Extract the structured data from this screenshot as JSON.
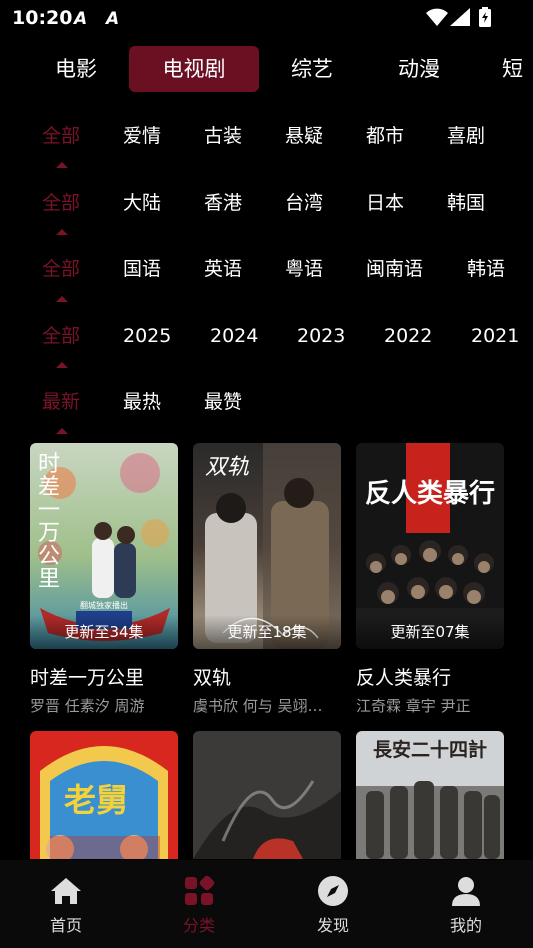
{
  "status_bar": {
    "time": "10:20",
    "notif1": "A",
    "notif2": "A"
  },
  "top_tabs": [
    {
      "label": "电影"
    },
    {
      "label": "电视剧",
      "active": true
    },
    {
      "label": "综艺"
    },
    {
      "label": "动漫"
    },
    {
      "label": "短"
    }
  ],
  "filters": {
    "genre": [
      "全部",
      "爱情",
      "古装",
      "悬疑",
      "都市",
      "喜剧"
    ],
    "region": [
      "全部",
      "大陆",
      "香港",
      "台湾",
      "日本",
      "韩国"
    ],
    "language": [
      "全部",
      "国语",
      "英语",
      "粤语",
      "闽南语",
      "韩语"
    ],
    "year": [
      "全部",
      "2025",
      "2024",
      "2023",
      "2022",
      "2021"
    ],
    "sort": [
      "最新",
      "最热",
      "最赞"
    ]
  },
  "cards": [
    {
      "title": "时差一万公里",
      "episodes": "更新至34集",
      "cast": "罗晋  任素汐  周游",
      "poster_text": "时差一万公里",
      "poster_badge": "翻城独家播出"
    },
    {
      "title": "双轨",
      "episodes": "更新至18集",
      "cast": "虞书欣  何与  吴翊…",
      "poster_text": "双轨"
    },
    {
      "title": "反人类暴行",
      "episodes": "更新至07集",
      "cast": "江奇霖  章宇  尹正",
      "poster_text": "反人类暴行"
    }
  ],
  "cards_row2": [
    {
      "poster_text": "老舅"
    },
    {
      "poster_text": ""
    },
    {
      "poster_text": "長安二十四計"
    }
  ],
  "bottom_nav": [
    {
      "label": "首页",
      "icon": "home-icon"
    },
    {
      "label": "分类",
      "icon": "category-icon",
      "active": true
    },
    {
      "label": "发现",
      "icon": "compass-icon"
    },
    {
      "label": "我的",
      "icon": "user-icon"
    }
  ],
  "colors": {
    "accent": "#7a1327",
    "active_tab_bg": "#6b0f22",
    "background": "#000000"
  }
}
